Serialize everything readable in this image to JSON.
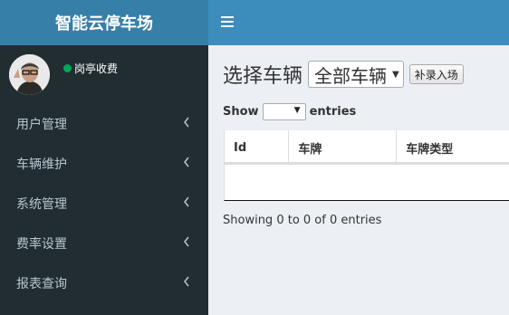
{
  "header": {
    "logo_text": "智能云停车场"
  },
  "user": {
    "status": "岗亭收费"
  },
  "sidebar": {
    "items": [
      {
        "label": "用户管理"
      },
      {
        "label": "车辆维护"
      },
      {
        "label": "系统管理"
      },
      {
        "label": "费率设置"
      },
      {
        "label": "报表查询"
      }
    ]
  },
  "main": {
    "title": "选择车辆",
    "select_value": "全部车辆",
    "supplement_button": "补录入场",
    "show_label": "Show",
    "entries_label": "entries",
    "table": {
      "columns": [
        "Id",
        "车牌",
        "车牌类型"
      ]
    },
    "info": "Showing 0 to 0 of 0 entries"
  },
  "colors": {
    "header": "#3c8dbc",
    "logo_bg": "#367fa9",
    "sidebar": "#222d32",
    "status": "#00a65a"
  }
}
